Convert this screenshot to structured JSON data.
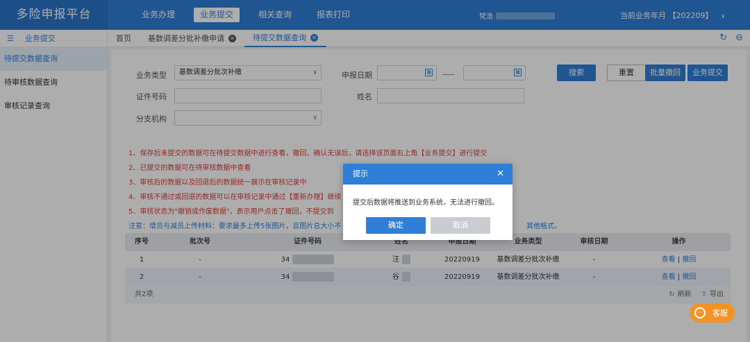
{
  "app": {
    "title": "多险申报平台"
  },
  "topnav": [
    {
      "label": "业务办理",
      "active": false
    },
    {
      "label": "业务提交",
      "active": true
    },
    {
      "label": "相关查询",
      "active": false
    },
    {
      "label": "报表打印",
      "active": false
    }
  ],
  "user": {
    "name": "梵浩"
  },
  "period": {
    "label": "当前业务年月",
    "value": "【202209】"
  },
  "sidebar": {
    "header": "业务提交",
    "items": [
      {
        "label": "待提交数据查询",
        "active": true
      },
      {
        "label": "待审核数据查询",
        "active": false
      },
      {
        "label": "审核记录查询",
        "active": false
      }
    ]
  },
  "tabs": [
    {
      "label": "首页",
      "active": false,
      "closable": false
    },
    {
      "label": "基数调差分批补缴申请",
      "active": false,
      "closable": true
    },
    {
      "label": "待提交数据查询",
      "active": true,
      "closable": true
    }
  ],
  "form": {
    "business_type_label": "业务类型",
    "business_type_value": "基数调差分批次补缴",
    "report_date_label": "申报日期",
    "id_label": "证件号码",
    "name_label": "姓名",
    "branch_label": "分支机构"
  },
  "buttons": {
    "search": "搜索",
    "reset": "重置",
    "batch_withdraw": "批量撤回",
    "submit": "业务提交"
  },
  "notices": [
    "1、保存后未提交的数据可在待提交数据中进行查看，撤回，确认无误后，请选择该页面右上角【业务提交】进行提交",
    "2、已提交的数据可在待审核数据中查看",
    "3、审核后的数据以及回退后的数据统一展示在审核记录中",
    "4、审核不通过或回退的数据可以在审核记录中通过【重新办理】继续",
    "5、审核状态为\"撤销或作废数据\"，表示用户点击了撤回，不提交到"
  ],
  "notice_blue": "注意：增员与减员上传材料：要求最多上传5张图片，且图片总大小不",
  "notice_blue_tail": "其他格式。",
  "table": {
    "headers": [
      "序号",
      "批次号",
      "证件号码",
      "姓名",
      "申报日期",
      "业务类型",
      "审核日期",
      "操作"
    ],
    "rows": [
      {
        "no": "1",
        "batch": "-",
        "id": "34",
        "name": "汪",
        "date": "20220919",
        "type": "基数调差分批次补缴",
        "audit": "-",
        "view": "查看",
        "sep": "|",
        "withdraw": "撤回"
      },
      {
        "no": "2",
        "batch": "-",
        "id": "34",
        "name": "谷",
        "date": "20220919",
        "type": "基数调差分批次补缴",
        "audit": "-",
        "view": "查看",
        "sep": "|",
        "withdraw": "撤回"
      }
    ],
    "total": "共2项",
    "refresh": "刷新",
    "export": "导出"
  },
  "modal": {
    "title": "提示",
    "message": "提交后数据将推送到业务系统，无法进行撤回。",
    "ok": "确定",
    "cancel": "取消"
  },
  "service": {
    "label": "客服"
  },
  "colors": {
    "primary": "#2f7fd8",
    "danger": "#e03c31",
    "service": "#f39325"
  }
}
